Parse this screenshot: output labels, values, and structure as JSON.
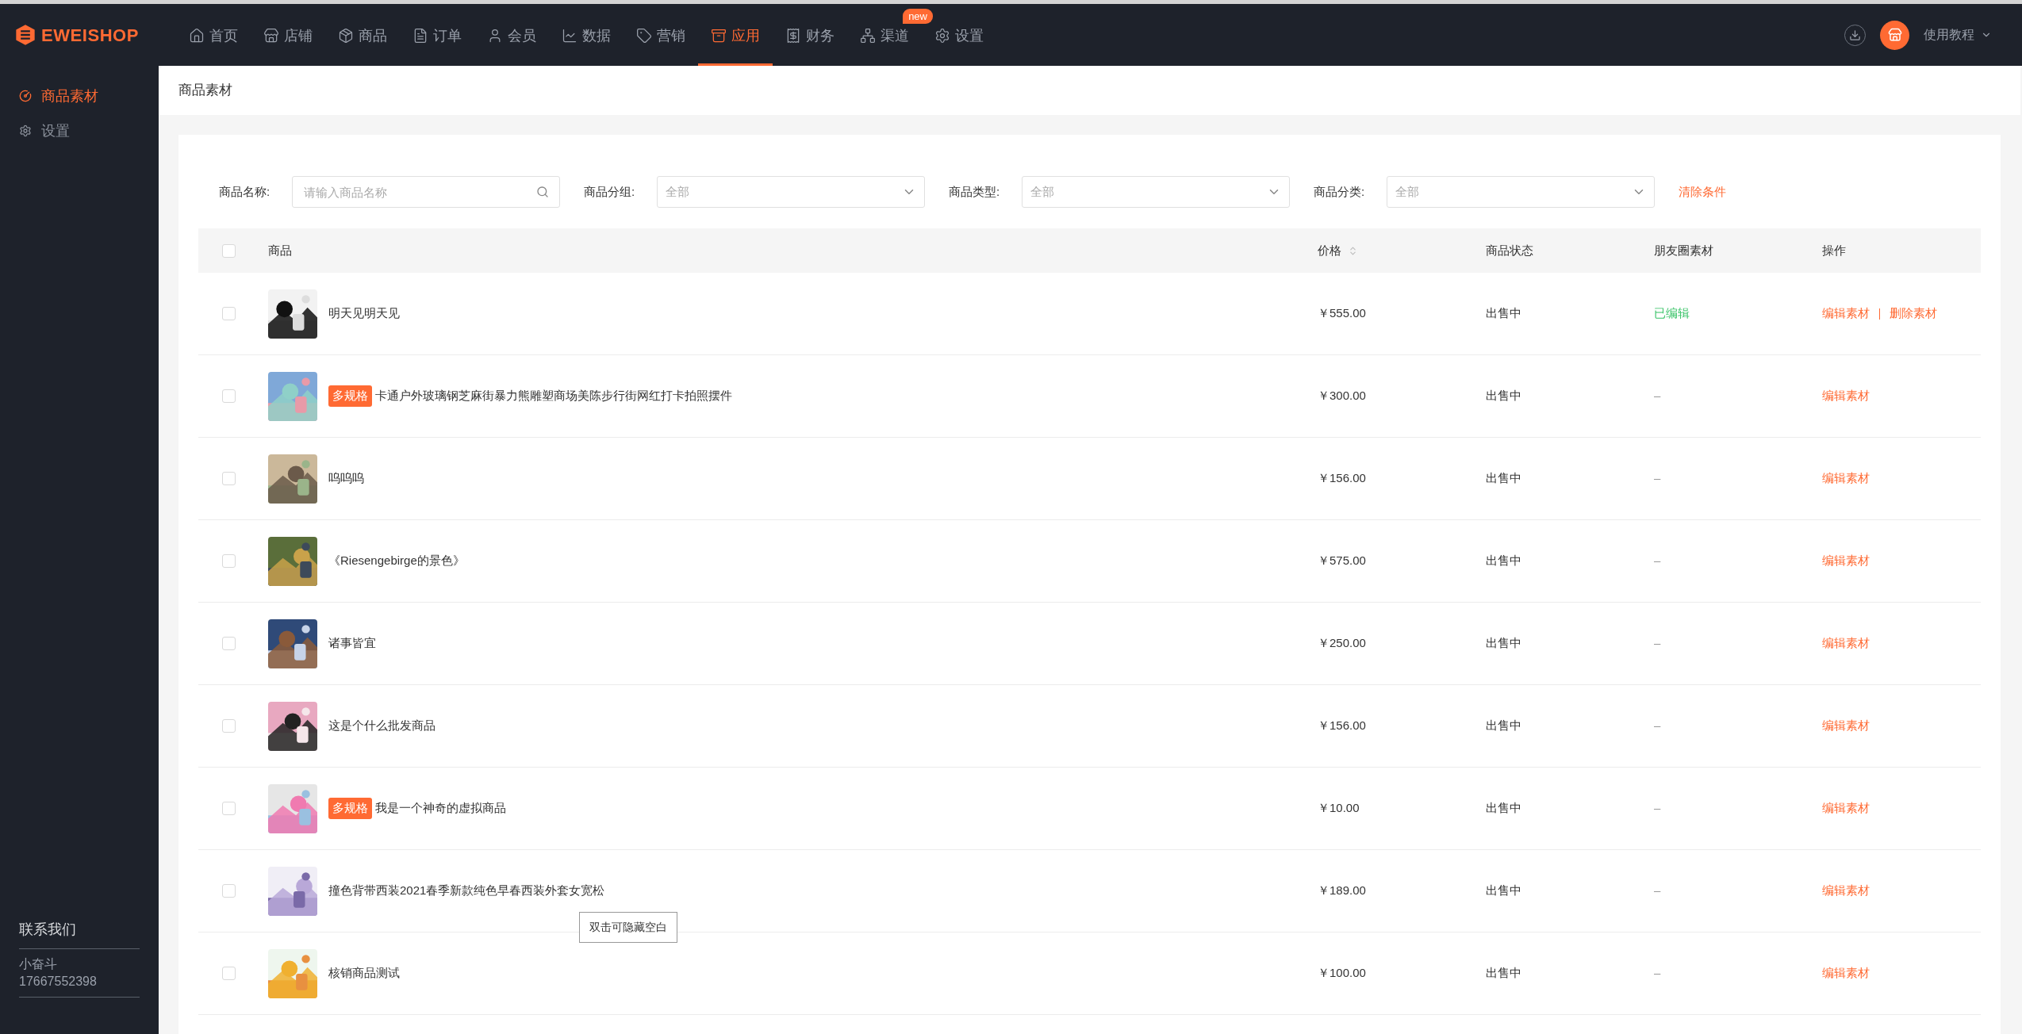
{
  "brand": "EWEISHOP",
  "nav": [
    {
      "label": "首页",
      "selected": false
    },
    {
      "label": "店铺",
      "selected": false
    },
    {
      "label": "商品",
      "selected": false
    },
    {
      "label": "订单",
      "selected": false
    },
    {
      "label": "会员",
      "selected": false
    },
    {
      "label": "数据",
      "selected": false
    },
    {
      "label": "营销",
      "selected": false
    },
    {
      "label": "应用",
      "selected": true
    },
    {
      "label": "财务",
      "selected": false
    },
    {
      "label": "渠道",
      "selected": false,
      "badge": "new"
    },
    {
      "label": "设置",
      "selected": false
    }
  ],
  "user_menu": "使用教程",
  "sidebar": {
    "items": [
      {
        "label": "商品素材",
        "selected": true
      },
      {
        "label": "设置",
        "selected": false
      }
    ],
    "contact": {
      "title": "联系我们",
      "name": "小奋斗",
      "phone": "17667552398"
    }
  },
  "page_title": "商品素材",
  "filters": [
    {
      "label": "商品名称:",
      "kind": "search",
      "placeholder": "请输入商品名称"
    },
    {
      "label": "商品分组:",
      "kind": "select",
      "value": "全部"
    },
    {
      "label": "商品类型:",
      "kind": "select",
      "value": "全部"
    },
    {
      "label": "商品分类:",
      "kind": "select",
      "value": "全部"
    }
  ],
  "clear_filters": "清除条件",
  "table": {
    "columns": [
      "商品",
      "价格",
      "商品状态",
      "朋友圈素材",
      "操作"
    ],
    "all_checked": false,
    "rows": [
      {
        "checked": false,
        "name": "明天见明天见",
        "price": "￥555.00",
        "status": "出售中",
        "moments": "已编辑",
        "edited": true,
        "actions": [
          "编辑素材",
          "删除素材"
        ]
      },
      {
        "checked": false,
        "tag": "多规格",
        "name": "卡通户外玻璃钢芝麻街暴力熊雕塑商场美陈步行街网红打卡拍照摆件",
        "price": "￥300.00",
        "status": "出售中",
        "moments": "–",
        "edited": false,
        "actions": [
          "编辑素材"
        ]
      },
      {
        "checked": false,
        "name": "呜呜呜",
        "price": "￥156.00",
        "status": "出售中",
        "moments": "–",
        "edited": false,
        "actions": [
          "编辑素材"
        ]
      },
      {
        "checked": false,
        "name": "《Riesengebirge的景色》",
        "price": "￥575.00",
        "status": "出售中",
        "moments": "–",
        "edited": false,
        "actions": [
          "编辑素材"
        ]
      },
      {
        "checked": false,
        "name": "诸事皆宜",
        "price": "￥250.00",
        "status": "出售中",
        "moments": "–",
        "edited": false,
        "actions": [
          "编辑素材"
        ]
      },
      {
        "checked": false,
        "name": "这是个什么批发商品",
        "price": "￥156.00",
        "status": "出售中",
        "moments": "–",
        "edited": false,
        "actions": [
          "编辑素材"
        ]
      },
      {
        "checked": false,
        "tag": "多规格",
        "name": "我是一个神奇的虚拟商品",
        "price": "￥10.00",
        "status": "出售中",
        "moments": "–",
        "edited": false,
        "actions": [
          "编辑素材"
        ]
      },
      {
        "checked": false,
        "name": "撞色背带西装2021春季新款纯色早春西装外套女宽松",
        "price": "￥189.00",
        "status": "出售中",
        "moments": "–",
        "edited": false,
        "actions": [
          "编辑素材"
        ]
      },
      {
        "checked": false,
        "name": "核销商品测试",
        "price": "￥100.00",
        "status": "出售中",
        "moments": "–",
        "edited": false,
        "actions": [
          "编辑素材"
        ]
      }
    ]
  },
  "tooltip": "双击可隐藏空白"
}
